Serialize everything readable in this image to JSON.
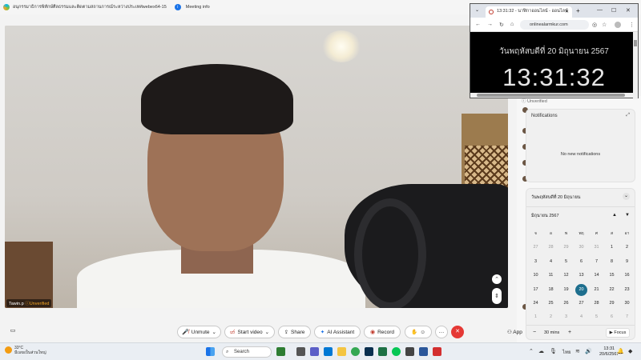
{
  "window": {
    "title": "อนุกรรมาธิการพิทักษ์ศีลธรรมและติดตามสถานการณ์ระหว่างประเทศwebex64-15",
    "meeting_info": "Meeting info"
  },
  "video": {
    "participant_name": "Tawin.p",
    "participant_status": "Unverified"
  },
  "right_panel": {
    "unverified_label": "Unverified"
  },
  "notifications": {
    "title": "Notifications",
    "empty_text": "No new notifications"
  },
  "calendar": {
    "header_date": "วันพฤหัสบดีที่ 20 มิถุนายน",
    "month_year": "มิถุนายน 2567",
    "weekdays": [
      "จ",
      "อ",
      "พ",
      "พฤ",
      "ศ",
      "ส",
      "อา"
    ],
    "days": [
      {
        "d": "27",
        "dim": true
      },
      {
        "d": "28",
        "dim": true
      },
      {
        "d": "29",
        "dim": true
      },
      {
        "d": "30",
        "dim": true
      },
      {
        "d": "31",
        "dim": true
      },
      {
        "d": "1"
      },
      {
        "d": "2"
      },
      {
        "d": "3"
      },
      {
        "d": "4"
      },
      {
        "d": "5"
      },
      {
        "d": "6"
      },
      {
        "d": "7"
      },
      {
        "d": "8"
      },
      {
        "d": "9"
      },
      {
        "d": "10"
      },
      {
        "d": "11"
      },
      {
        "d": "12"
      },
      {
        "d": "13"
      },
      {
        "d": "14"
      },
      {
        "d": "15"
      },
      {
        "d": "16"
      },
      {
        "d": "17"
      },
      {
        "d": "18"
      },
      {
        "d": "19"
      },
      {
        "d": "20",
        "today": true
      },
      {
        "d": "21"
      },
      {
        "d": "22"
      },
      {
        "d": "23"
      },
      {
        "d": "24"
      },
      {
        "d": "25"
      },
      {
        "d": "26"
      },
      {
        "d": "27"
      },
      {
        "d": "28"
      },
      {
        "d": "29"
      },
      {
        "d": "30"
      },
      {
        "d": "1",
        "dim": true
      },
      {
        "d": "2",
        "dim": true
      },
      {
        "d": "3",
        "dim": true
      },
      {
        "d": "4",
        "dim": true
      },
      {
        "d": "5",
        "dim": true
      },
      {
        "d": "6",
        "dim": true
      },
      {
        "d": "7",
        "dim": true
      }
    ],
    "focus_minutes": "30 mins",
    "focus_label": "Focus"
  },
  "browser": {
    "tab_title": "13:31:32 - นาฬิกาออนไลน์ - ออนไลน์",
    "url": "onlinealarmkur.com",
    "date_text": "วันพฤหัสบดีที่ 20 มิถุนายน 2567",
    "time_text": "13:31:32"
  },
  "controls": {
    "unmute": "Unmute",
    "start_video": "Start video",
    "share": "Share",
    "ai_assistant": "AI Assistant",
    "record": "Record",
    "apps": "App"
  },
  "taskbar": {
    "weather_temp": "33°C",
    "weather_desc": "มีเมฆเป็นส่วนใหญ่",
    "search_placeholder": "Search",
    "lang": "ไทย",
    "clock_time": "13:31",
    "clock_date": "20/6/2567"
  }
}
